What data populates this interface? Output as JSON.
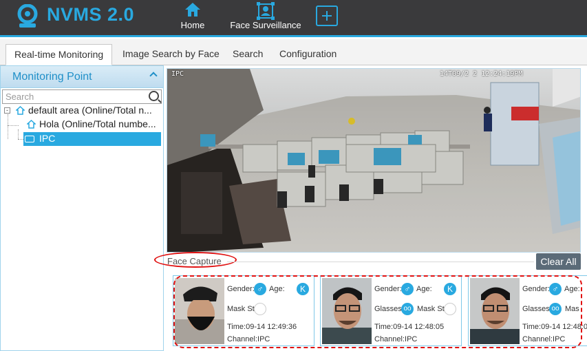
{
  "app": {
    "title": "NVMS 2.0"
  },
  "nav": {
    "items": [
      {
        "label": "Home",
        "icon": "home-icon"
      },
      {
        "label": "Face Surveillance",
        "icon": "face-surveillance-icon"
      }
    ],
    "add_icon": "plus-icon"
  },
  "tabs": [
    {
      "label": "Real-time Monitoring",
      "active": true
    },
    {
      "label": "Image Search by Face",
      "active": false
    },
    {
      "label": "Search",
      "active": false
    },
    {
      "label": "Configuration",
      "active": false
    }
  ],
  "sidebar": {
    "title": "Monitoring Point",
    "search_placeholder": "Search",
    "tree": [
      {
        "label": "default area (Online/Total n...",
        "expander": "-"
      },
      {
        "label": "Hola (Online/Total numbe..."
      },
      {
        "label": "IPC",
        "selected": true
      }
    ]
  },
  "video": {
    "channel_label": "IPC",
    "timestamp": "14T09/2 2 12:24:19PM"
  },
  "face_capture": {
    "title": "Face Capture",
    "clear_label": "Clear All",
    "cards": [
      {
        "gender_label": "Gender:",
        "age_label": "Age:",
        "age_badge": "K",
        "attr_label": "Mask St",
        "time": "Time:09-14 12:49:36",
        "channel": "Channel:IPC"
      },
      {
        "gender_label": "Gender:",
        "age_label": "Age:",
        "age_badge": "K",
        "glasses_label": "Glasses:",
        "attr_label": "Mask St",
        "time": "Time:09-14 12:48:05",
        "channel": "Channel:IPC"
      },
      {
        "gender_label": "Gender:",
        "age_label": "Age:",
        "age_badge": "K",
        "glasses_label": "Glasses:",
        "attr_label": "Mas",
        "time": "Time:09-14 12:48:0",
        "channel": "Channel:IPC"
      }
    ]
  },
  "colors": {
    "accent": "#29a9e0",
    "header_bg": "#3a3a3c",
    "highlight_red": "#e01010"
  }
}
